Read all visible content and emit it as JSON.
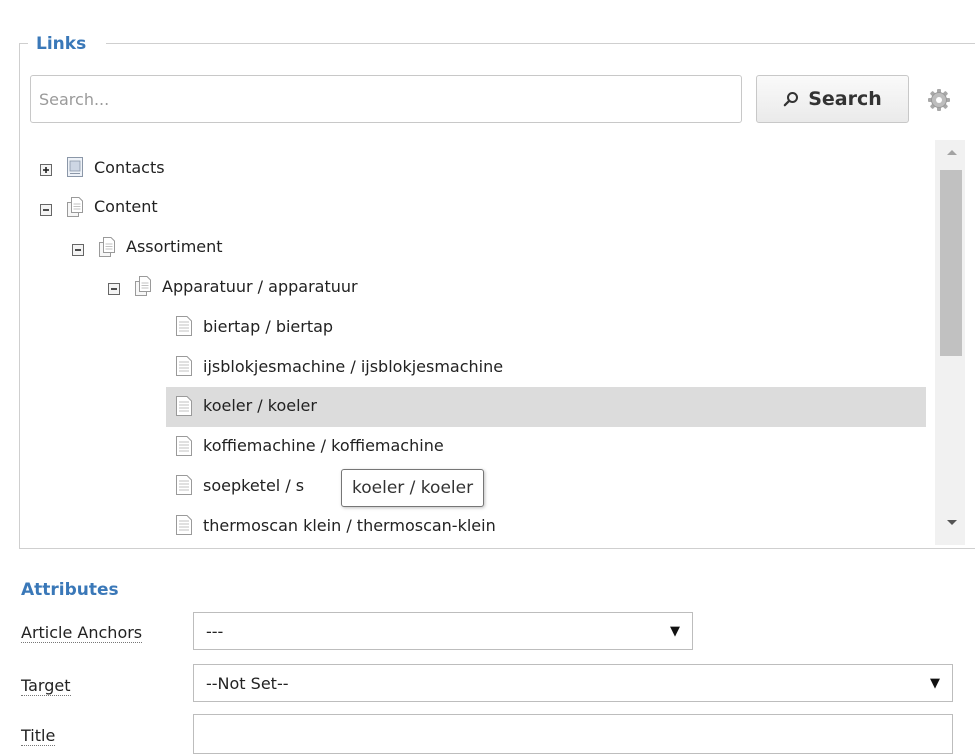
{
  "links": {
    "legend": "Links",
    "search_placeholder": "Search...",
    "search_button": "Search"
  },
  "tree": [
    {
      "label": "Contacts",
      "level": 0,
      "toggle": "plus",
      "icon": "folder-page"
    },
    {
      "label": "Content",
      "level": 0,
      "toggle": "minus",
      "icon": "pages"
    },
    {
      "label": "Assortiment",
      "level": 1,
      "toggle": "minus",
      "icon": "pages"
    },
    {
      "label": "Apparatuur / apparatuur",
      "level": 2,
      "toggle": "minus",
      "icon": "pages"
    },
    {
      "label": "biertap / biertap",
      "level": 3,
      "toggle": "none",
      "icon": "page"
    },
    {
      "label": "ijsblokjesmachine / ijsblokjesmachine",
      "level": 3,
      "toggle": "none",
      "icon": "page"
    },
    {
      "label": "koeler / koeler",
      "level": 3,
      "toggle": "none",
      "icon": "page",
      "selected": true
    },
    {
      "label": "koffiemachine / koffiemachine",
      "level": 3,
      "toggle": "none",
      "icon": "page"
    },
    {
      "label": "soepketel / s",
      "level": 3,
      "toggle": "none",
      "icon": "page"
    },
    {
      "label": "thermoscan klein / thermoscan-klein",
      "level": 3,
      "toggle": "none",
      "icon": "page"
    }
  ],
  "tooltip": "koeler / koeler",
  "attributes": {
    "heading": "Attributes",
    "article_anchors": {
      "label": "Article Anchors",
      "value": "---"
    },
    "target": {
      "label": "Target",
      "value": "--Not Set--"
    },
    "title": {
      "label": "Title",
      "value": ""
    }
  },
  "colors": {
    "accent": "#3a78b8",
    "selected_row": "#dcdcdc"
  }
}
